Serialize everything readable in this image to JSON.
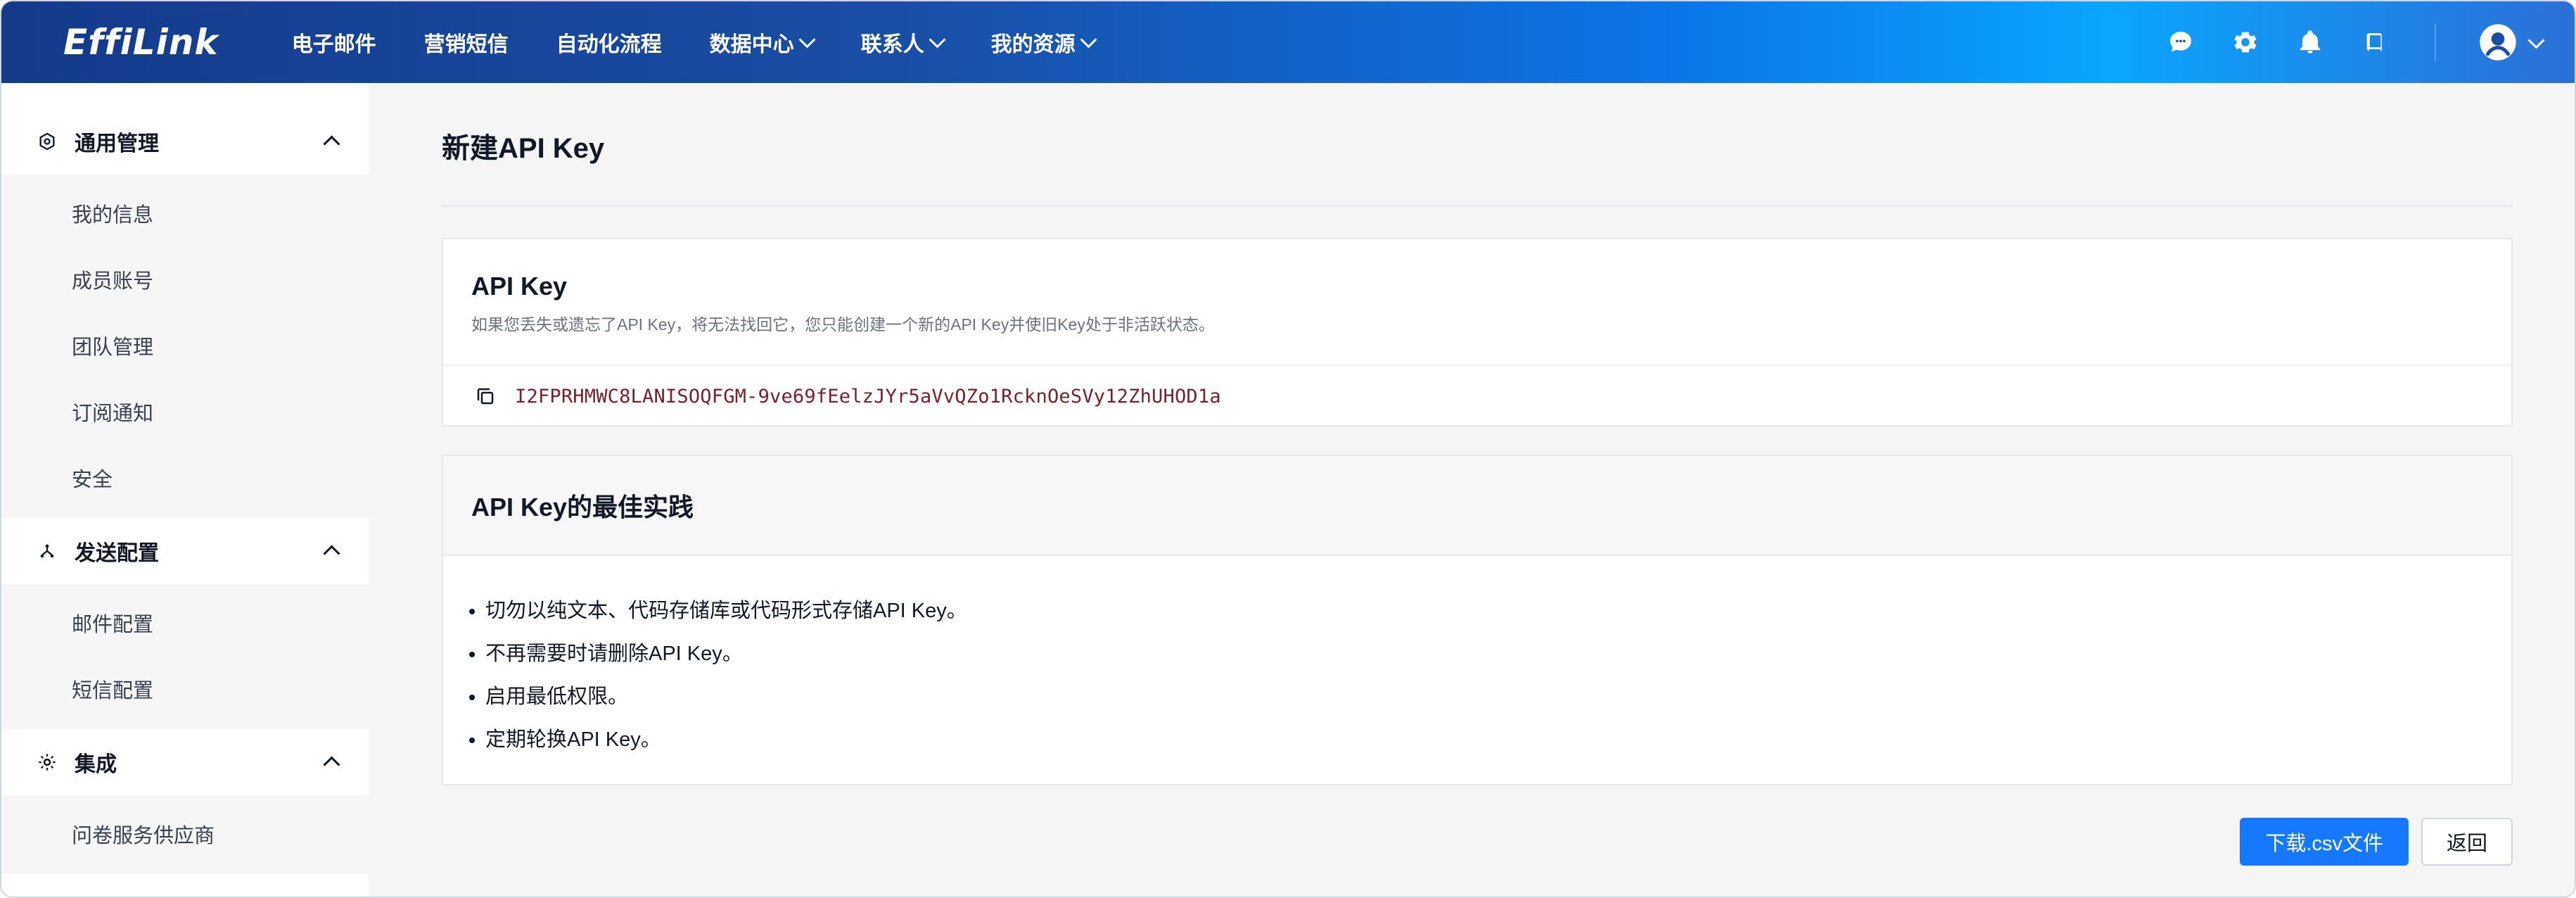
{
  "app": {
    "logo_text": "EffiLink"
  },
  "topnav": {
    "items": [
      {
        "label": "电子邮件",
        "has_dropdown": false
      },
      {
        "label": "营销短信",
        "has_dropdown": false
      },
      {
        "label": "自动化流程",
        "has_dropdown": false
      },
      {
        "label": "数据中心",
        "has_dropdown": true
      },
      {
        "label": "联系人",
        "has_dropdown": true
      },
      {
        "label": "我的资源",
        "has_dropdown": true
      }
    ],
    "icons": [
      "chat-icon",
      "gear-icon",
      "bell-icon",
      "book-icon",
      "user-avatar-icon",
      "chevron-down-icon"
    ]
  },
  "sidebar": {
    "sections": [
      {
        "title": "通用管理",
        "icon": "settings-icon",
        "expanded": true,
        "items": [
          "我的信息",
          "成员账号",
          "团队管理",
          "订阅通知",
          "安全"
        ]
      },
      {
        "title": "发送配置",
        "icon": "send-config-icon",
        "expanded": true,
        "items": [
          "邮件配置",
          "短信配置"
        ]
      },
      {
        "title": "集成",
        "icon": "integration-icon",
        "expanded": true,
        "items": [
          "问卷服务供应商"
        ]
      }
    ]
  },
  "main": {
    "page_title": "新建API Key",
    "api_key_card": {
      "title": "API Key",
      "description": "如果您丢失或遗忘了API Key，将无法找回它，您只能创建一个新的API Key并使旧Key处于非活跃状态。",
      "key_value": "I2FPRHMWC8LANISOQFGM-9ve69fEelzJYr5aVvQZo1RcknOeSVy12ZhUHOD1a"
    },
    "best_practices_card": {
      "title": "API Key的最佳实践",
      "items": [
        "切勿以纯文本、代码存储库或代码形式存储API Key。",
        "不再需要时请删除API Key。",
        "启用最低权限。",
        "定期轮换API Key。"
      ]
    },
    "actions": {
      "download_label": "下载.csv文件",
      "back_label": "返回"
    }
  },
  "colors": {
    "accent": "#1677ff",
    "key_text": "#7a1f2b"
  }
}
